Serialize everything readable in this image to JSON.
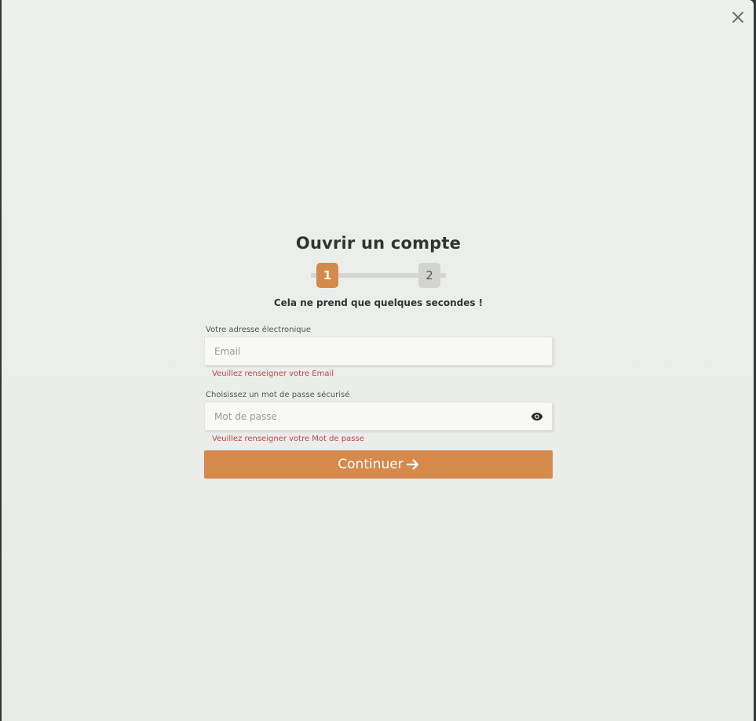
{
  "modal": {
    "close_icon": "close-icon"
  },
  "form": {
    "title": "Ouvrir un compte",
    "steps": [
      {
        "label": "1",
        "active": true
      },
      {
        "label": "2",
        "active": false
      }
    ],
    "subtitle": "Cela ne prend que quelques secondes !",
    "email": {
      "label": "Votre adresse électronique",
      "placeholder": "Email",
      "value": "",
      "error": "Veuillez renseigner votre Email"
    },
    "password": {
      "label": "Choisissez un mot de passe sécurisé",
      "placeholder": "Mot de passe",
      "value": "",
      "error": "Veuillez renseigner votre Mot de passe",
      "toggle_icon": "eye-icon"
    },
    "submit": {
      "label": "Continuer",
      "icon": "arrow-right-icon"
    }
  },
  "colors": {
    "accent": "#d58a4c",
    "error": "#c24747",
    "step_inactive": "#d3d3d1"
  }
}
